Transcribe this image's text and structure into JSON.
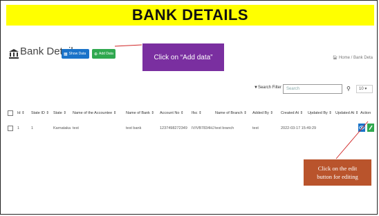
{
  "banner": {
    "title": "BANK DETAILS"
  },
  "header": {
    "page_title": "Bank Details",
    "show_data_label": "Show Data",
    "add_data_label": "Add Data",
    "breadcrumb": "Home / Bank Deta"
  },
  "callouts": {
    "add_data": "Click on “Add data”",
    "edit_line1": "Click on the edit",
    "edit_line2": "button for editing"
  },
  "toolbar": {
    "filter_label": "Search Filter",
    "search_placeholder": "Search",
    "page_size": "10"
  },
  "table": {
    "headers": [
      "Id",
      "State ID",
      "State",
      "Name of the Accountee",
      "Name of Bank",
      "Account No",
      "Ifsc",
      "Name of Branch",
      "Added By",
      "Created At",
      "Updated By",
      "Updated At",
      "Action"
    ],
    "rows": [
      [
        "1",
        "1",
        "Karnataka",
        "test",
        "test bank",
        "1237498272349",
        "IVIVB7834HJ",
        "test branch",
        "test",
        "2022-03-17 15:49:29",
        "",
        ""
      ]
    ]
  },
  "colors": {
    "banner_bg": "#ffff00",
    "callout_purple": "#7a2fa0",
    "callout_orange": "#b9542c",
    "show_btn": "#1a73c9",
    "add_btn": "#2fa84f"
  }
}
